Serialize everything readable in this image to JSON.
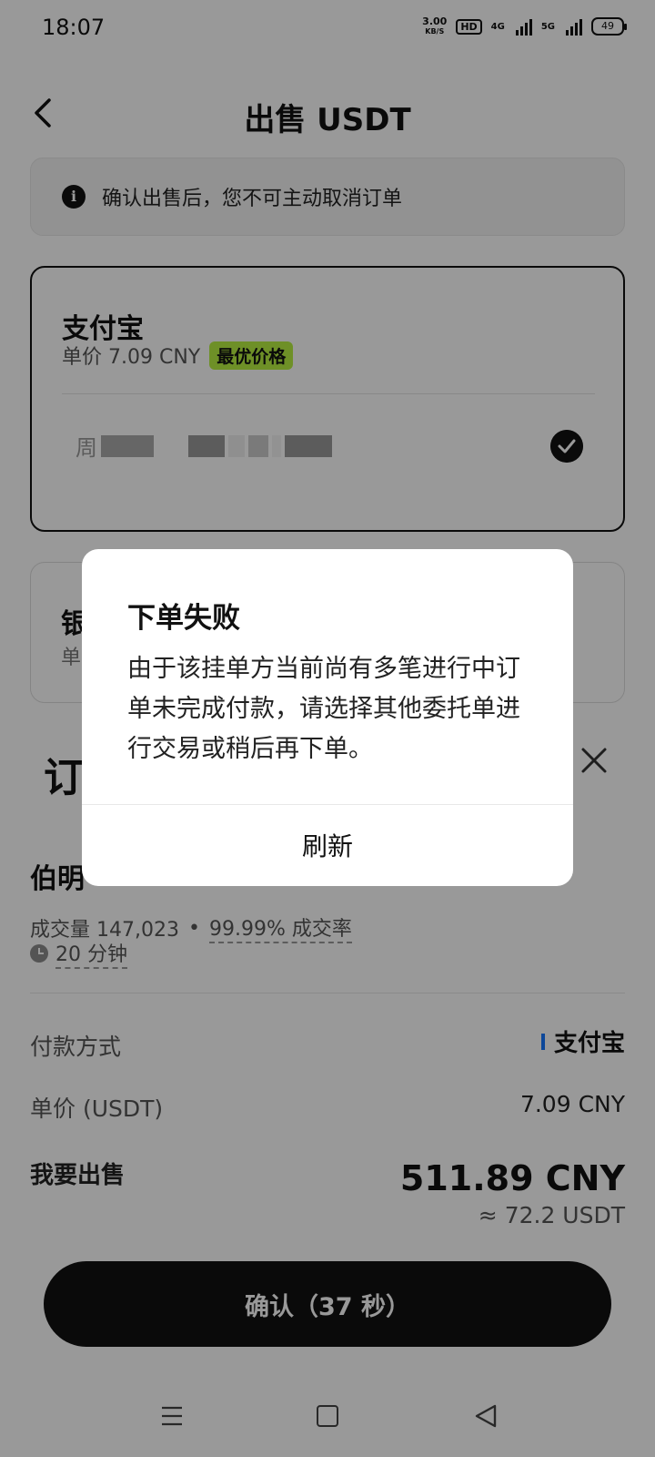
{
  "status_bar": {
    "time": "18:07",
    "net_speed_value": "3.00",
    "net_speed_unit": "KB/S",
    "hd": "HD",
    "signal1_label": "4G",
    "signal2_label": "5G",
    "battery": "49"
  },
  "header": {
    "title": "出售 USDT"
  },
  "notice": {
    "icon": "info-icon",
    "text": "确认出售后，您不可主动取消订单"
  },
  "payment_option_1": {
    "name": "支付宝",
    "price": "单价 7.09 CNY",
    "badge": "最优价格",
    "account_first_char": "周",
    "selected": true
  },
  "payment_option_2": {
    "name": "银",
    "price": "单"
  },
  "order": {
    "title": "订",
    "merchant_name": "伯明",
    "volume": "成交量 147,023",
    "separator": "•",
    "completion_rate": "99.99% 成交率",
    "time": "20 分钟",
    "payment_method_label": "付款方式",
    "payment_method_value": "支付宝",
    "unit_price_label": "单价 (USDT)",
    "unit_price_value": "7.09 CNY",
    "sell_label": "我要出售",
    "sell_amount": "511.89 CNY",
    "sell_sub": "≈ 72.2 USDT"
  },
  "confirm_button": {
    "label": "确认（37 秒）"
  },
  "dialog": {
    "title": "下单失败",
    "message": "由于该挂单方当前尚有多笔进行中订单未完成付款，请选择其他委托单进行交易或稍后再下单。",
    "button": "刷新"
  },
  "colors": {
    "overlay": "#000000",
    "best_badge": "#b7f042",
    "alipay_accent": "#1677ff"
  }
}
